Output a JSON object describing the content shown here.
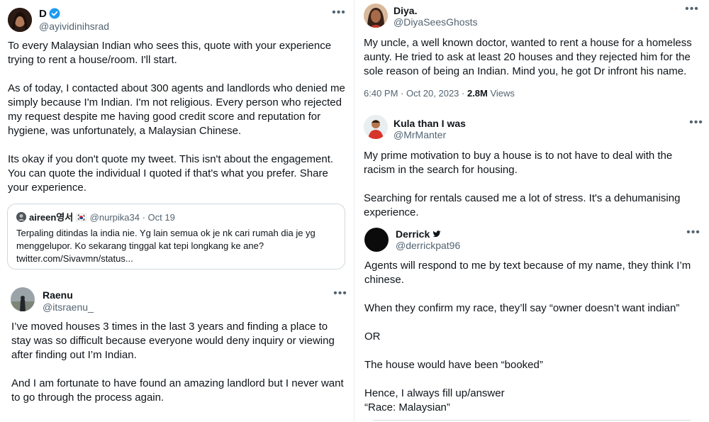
{
  "tweet1": {
    "name": "D",
    "handle": "@ayividinihsrad",
    "paragraphs": [
      "To every Malaysian Indian who sees this, quote with your experience trying to rent a house/room. I'll start.",
      "As of today, I contacted about 300 agents and landlords who denied me simply because I'm Indian. I'm not religious. Every person who rejected my request despite me having good credit score and reputation for hygiene, was unfortunately, a Malaysian Chinese.",
      "Its okay if you don't quote my tweet. This isn't about the engagement. You can quote the individual I quoted if that's what you prefer. Share your experience."
    ],
    "quote": {
      "name": "aireen영서",
      "flag": "🇰🇷",
      "handle": "@nurpika34",
      "date": "· Oct 19",
      "text": "Terpaling ditindas la india nie. Yg lain semua ok je nk cari rumah dia je yg menggelupor. Ko sekarang tinggal kat tepi longkang ke ane? twitter.com/Sivavmn/status..."
    }
  },
  "tweet2": {
    "name": "Raenu",
    "handle": "@itsraenu_",
    "paragraphs": [
      "I’ve moved houses 3 times in the last 3 years and finding a place to stay was so difficult because everyone would deny inquiry or viewing after finding out I’m Indian.",
      "And I am fortunate to have found an amazing landlord but I never want to go through the process again."
    ]
  },
  "tweet3": {
    "name": "Diya.",
    "handle": "@DiyaSeesGhosts",
    "paragraphs": [
      "My uncle, a well known doctor, wanted to rent a house for a homeless aunty. He tried to ask at least 20 houses and they rejected him for the sole reason of being an Indian. Mind you, he got Dr infront his name."
    ],
    "time": "6:40 PM · Oct 20, 2023 · ",
    "views_count": "2.8M",
    "views_label": " Views"
  },
  "tweet4": {
    "name": "Kula than I was",
    "handle": "@MrManter",
    "paragraphs": [
      "My prime motivation to buy a house is to not have to deal with the racism in the search for housing.",
      "Searching for rentals caused me a lot of stress. It's a dehumanising experience."
    ]
  },
  "tweet5": {
    "name": "Derrick",
    "handle": "@derrickpat96",
    "paragraphs": [
      "Agents will respond to me by text because of my name, they think I’m chinese.",
      "When they confirm my race, they’ll say “owner doesn’t want indian”",
      "OR",
      "The house would have been “booked”",
      "Hence, I always fill up/answer",
      "“Race: Malaysian”"
    ]
  },
  "more_glyph": "•••",
  "colors": {
    "text": "#0f1419",
    "secondary": "#536471",
    "verified": "#1d9bf0",
    "border": "#cfd9de"
  }
}
